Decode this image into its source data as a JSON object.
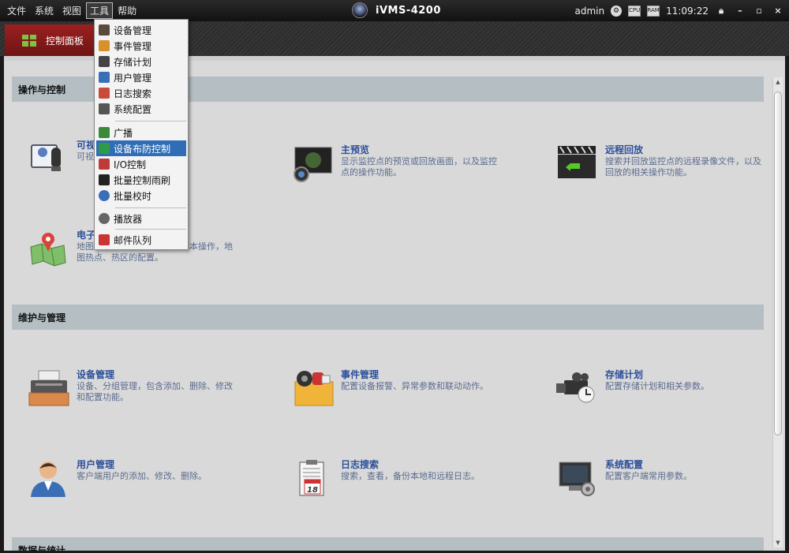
{
  "window": {
    "title": "iVMS-4200",
    "user": "admin",
    "cpu_label": "CPU",
    "ram_label": "RAM",
    "clock": "11:09:22"
  },
  "menubar": [
    {
      "label": "文件"
    },
    {
      "label": "系统"
    },
    {
      "label": "视图"
    },
    {
      "label": "工具",
      "active": true
    },
    {
      "label": "帮助"
    }
  ],
  "tab": {
    "label": "控制面板"
  },
  "tools_menu": {
    "items": [
      {
        "label": "设备管理",
        "icon": "device-manage-icon",
        "color": "#5a4a3a"
      },
      {
        "label": "事件管理",
        "icon": "event-manage-icon",
        "color": "#d9902a"
      },
      {
        "label": "存储计划",
        "icon": "storage-plan-icon",
        "color": "#444444"
      },
      {
        "label": "用户管理",
        "icon": "user-manage-icon",
        "color": "#3a6fb7"
      },
      {
        "label": "日志搜索",
        "icon": "log-search-icon",
        "color": "#c94a3a"
      },
      {
        "label": "系统配置",
        "icon": "system-config-icon",
        "color": "#555555"
      },
      {
        "label": "广播",
        "icon": "broadcast-icon",
        "color": "#3a8a3a"
      },
      {
        "label": "设备布防控制",
        "icon": "arming-control-icon",
        "color": "#2e9a4a",
        "highlighted": true
      },
      {
        "label": "I/O控制",
        "icon": "io-control-icon",
        "color": "#c03a3a"
      },
      {
        "label": "批量控制雨刷",
        "icon": "wiper-control-icon",
        "color": "#222222"
      },
      {
        "label": "批量校时",
        "icon": "time-sync-icon",
        "color": "#3a6fb7"
      },
      {
        "label": "播放器",
        "icon": "player-icon",
        "color": "#666666"
      },
      {
        "label": "邮件队列",
        "icon": "mail-queue-icon",
        "color": "#cc3333"
      }
    ]
  },
  "sections": {
    "operate": {
      "title": "操作与控制",
      "items": [
        {
          "title": "可视",
          "desc": "可视"
        },
        {
          "title": "主预览",
          "desc": "显示监控点的预览或回放画面，以及监控点的操作功能。"
        },
        {
          "title": "远程回放",
          "desc": "搜索并回放监控点的远程录像文件，以及回放的相关操作功能。"
        },
        {
          "title": "电子",
          "desc": "地图的添加、修改、删除及基本操作，地图热点、热区的配置。"
        }
      ]
    },
    "maintain": {
      "title": "维护与管理",
      "items": [
        {
          "title": "设备管理",
          "desc": "设备、分组管理，包含添加、删除、修改和配置功能。"
        },
        {
          "title": "事件管理",
          "desc": "配置设备报警、异常参数和联动动作。"
        },
        {
          "title": "存储计划",
          "desc": "配置存储计划和相关参数。"
        },
        {
          "title": "用户管理",
          "desc": "客户端用户的添加、修改、删除。"
        },
        {
          "title": "日志搜索",
          "desc": "搜索，查看，备份本地和远程日志。"
        },
        {
          "title": "系统配置",
          "desc": "配置客户端常用参数。"
        }
      ]
    },
    "stats": {
      "title": "数据与统计"
    }
  },
  "calendar_day": "18"
}
